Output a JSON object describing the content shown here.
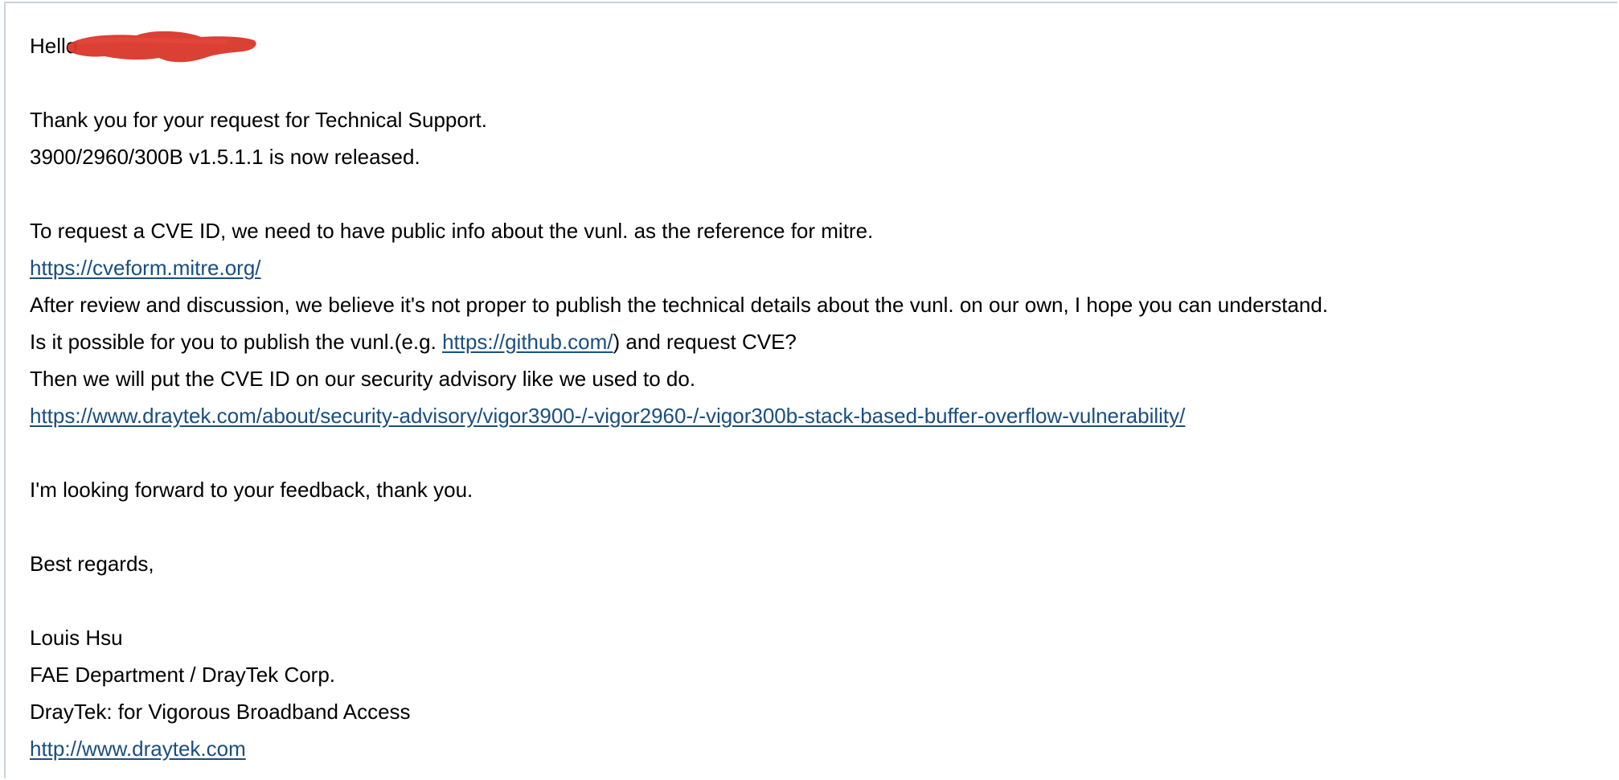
{
  "email": {
    "greeting": "Hello",
    "line_thanks": "Thank you for your request for Technical Support.",
    "line_release": "3900/2960/300B v1.5.1.1 is now released.",
    "line_cve_request": "To request a CVE ID, we need to have public info about the vunl. as the reference for mitre.",
    "link_cveform": "https://cveform.mitre.org/",
    "line_review": "After review and discussion, we believe it's not proper to publish the technical details about the vunl. on our own, I hope you can understand.",
    "line_possible_before": "Is it possible for you to publish the vunl.(e.g. ",
    "link_github": "https://github.com/",
    "line_possible_after": ") and request CVE?",
    "line_then": "Then we will put the CVE ID on our security advisory like we used to do.",
    "link_advisory": "https://www.draytek.com/about/security-advisory/vigor3900-/-vigor2960-/-vigor300b-stack-based-buffer-overflow-vulnerability/",
    "line_forward": "I'm looking forward to your feedback, thank you.",
    "line_regards": "Best regards,",
    "sig_name": "Louis Hsu",
    "sig_dept": "FAE Department / DrayTek Corp.",
    "sig_tagline": "DrayTek: for Vigorous Broadband Access",
    "link_website": "http://www.draytek.com"
  },
  "colors": {
    "link": "#1a4e7f",
    "redaction": "#d9362a",
    "frame_border": "#c9d2dc"
  }
}
